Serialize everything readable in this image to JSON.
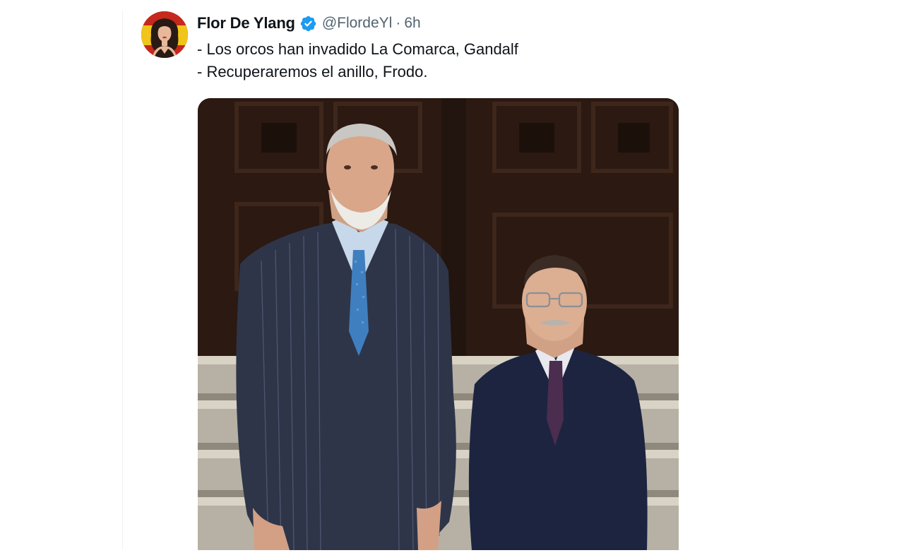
{
  "tweet": {
    "display_name": "Flor De Ylang",
    "handle": "@FlordeYl",
    "separator": "·",
    "time": "6h",
    "lines": [
      "- Los orcos han invadido La Comarca, Gandalf",
      "- Recuperaremos el anillo, Frodo."
    ],
    "avatar_icon": "woman-portrait-avatar",
    "verified_icon": "verified-badge-icon",
    "media": {
      "subject": "photo-two-men-in-suits"
    }
  },
  "colors": {
    "verified": "#1d9bf0",
    "text_primary": "#0f1419",
    "text_secondary": "#536471",
    "border": "#eff3f4"
  }
}
